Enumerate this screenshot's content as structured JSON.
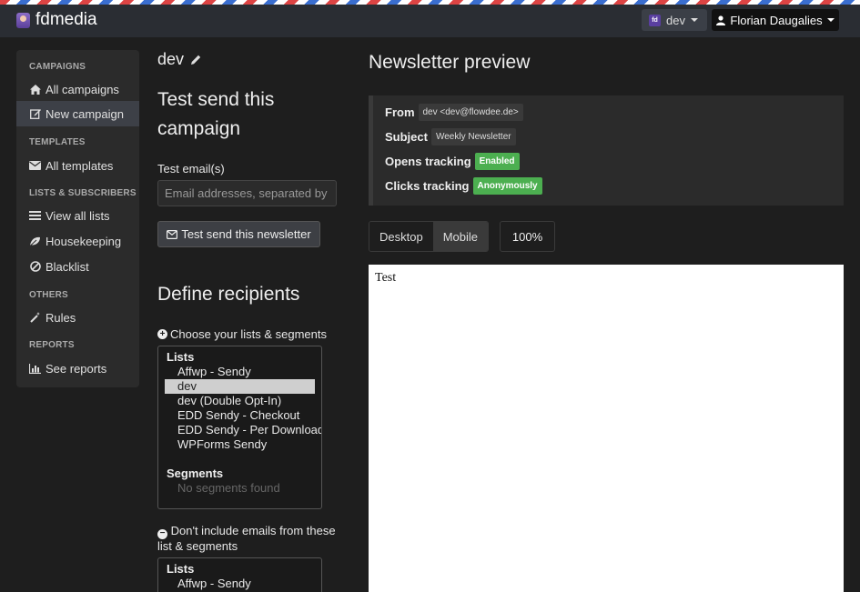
{
  "brand": {
    "name": "fdmedia"
  },
  "topbar": {
    "brand_switch_label": "dev",
    "brand_switch_icon_text": "fd",
    "user_name": "Florian Daugalies"
  },
  "sidebar": {
    "sections": [
      {
        "heading": "CAMPAIGNS"
      },
      {
        "heading": "TEMPLATES"
      },
      {
        "heading": "LISTS & SUBSCRIBERS"
      },
      {
        "heading": "OTHERS"
      },
      {
        "heading": "REPORTS"
      }
    ],
    "items": [
      {
        "label": "All campaigns",
        "icon": "home-icon"
      },
      {
        "label": "New campaign",
        "icon": "edit-icon",
        "active": true
      },
      {
        "label": "All templates",
        "icon": "envelope-icon"
      },
      {
        "label": "View all lists",
        "icon": "list-icon"
      },
      {
        "label": "Housekeeping",
        "icon": "leaf-icon"
      },
      {
        "label": "Blacklist",
        "icon": "ban-icon"
      },
      {
        "label": "Rules",
        "icon": "magic-wand-icon"
      },
      {
        "label": "See reports",
        "icon": "bar-chart-icon"
      }
    ]
  },
  "campaign": {
    "name": "dev"
  },
  "test_send": {
    "heading": "Test send this campaign",
    "email_label": "Test email(s)",
    "email_placeholder": "Email addresses, separated by comma",
    "button_label": "Test send this newsletter"
  },
  "recipients": {
    "heading": "Define recipients",
    "choose_label": "Choose your lists & segments",
    "include_box": {
      "lists_heading": "Lists",
      "lists": [
        "Affwp - Sendy",
        "dev",
        "dev (Double Opt-In)",
        "EDD Sendy - Checkout",
        "EDD Sendy - Per Download",
        "WPForms Sendy"
      ],
      "selected": "dev",
      "segments_heading": "Segments",
      "segments_empty": "No segments found"
    },
    "exclude_label": "Don't include emails from these list & segments",
    "exclude_box": {
      "lists_heading": "Lists",
      "lists": [
        "Affwp - Sendy"
      ]
    }
  },
  "preview": {
    "heading": "Newsletter preview",
    "from_label": "From",
    "from_value": "dev <dev@flowdee.de>",
    "subject_label": "Subject",
    "subject_value": "Weekly Newsletter",
    "opens_label": "Opens tracking",
    "opens_value": "Enabled",
    "clicks_label": "Clicks tracking",
    "clicks_value": "Anonymously",
    "view_desktop": "Desktop",
    "view_mobile": "Mobile",
    "zoom": "100%",
    "body_text": "Test"
  },
  "colors": {
    "success": "#4caf50",
    "selected_option": "#cfcfcf",
    "sidebar_active": "#3d4047"
  }
}
